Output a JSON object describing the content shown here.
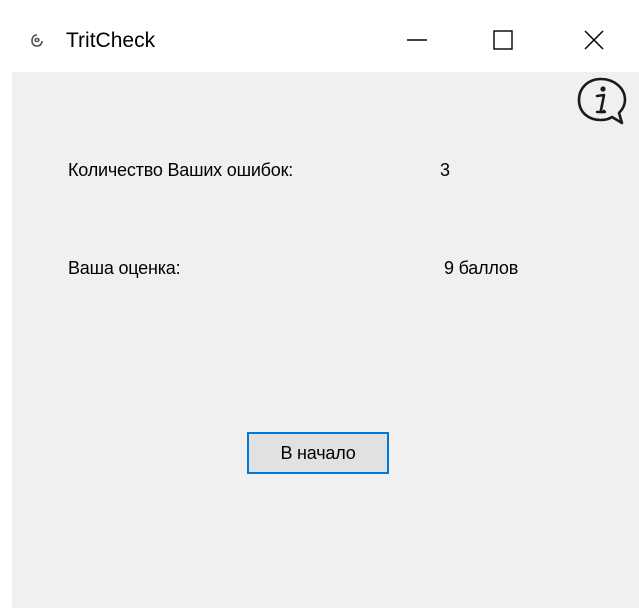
{
  "window": {
    "title": "TritCheck",
    "icons": {
      "app": "app-icon",
      "minimize": "minimize-icon",
      "maximize": "maximize-icon",
      "close": "close-icon"
    }
  },
  "main": {
    "info_icon": "info-icon",
    "errors": {
      "label": "Количество Ваших ошибок:",
      "value": "3"
    },
    "grade": {
      "label": "Ваша оценка:",
      "value": "9 баллов"
    },
    "start_button_label": "В начало"
  },
  "colors": {
    "client_background": "#f0f0f0",
    "titlebar_background": "#ffffff",
    "button_face": "#e1e1e1",
    "button_focus_border": "#0078d7"
  }
}
